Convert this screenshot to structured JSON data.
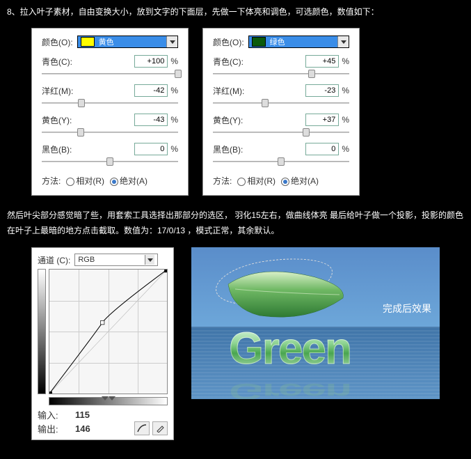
{
  "step8_text": "8、拉入叶子素材，自由变换大小，放到文字的下面层，先做一下体亮和调色，可选颜色，数值如下：",
  "panel_yellow": {
    "color_label": "颜色(O):",
    "name": "黄色",
    "cyan_label": "青色(C):",
    "cyan_val": "+100",
    "magenta_label": "洋红(M):",
    "magenta_val": "-42",
    "yellow_label": "黄色(Y):",
    "yellow_val": "-43",
    "black_label": "黑色(B):",
    "black_val": "0",
    "method": "方法:",
    "rel": "相对(R)",
    "abs": "绝对(A)",
    "pct": "%"
  },
  "panel_green": {
    "color_label": "颜色(O):",
    "name": "绿色",
    "cyan_label": "青色(C):",
    "cyan_val": "+45",
    "magenta_label": "洋红(M):",
    "magenta_val": "-23",
    "yellow_label": "黄色(Y):",
    "yellow_val": "+37",
    "black_label": "黑色(B):",
    "black_val": "0",
    "method": "方法:",
    "rel": "相对(R)",
    "abs": "绝对(A)",
    "pct": "%"
  },
  "paragraph2": "然后叶尖部分感觉暗了些，用套索工具选择出那部分的选区，  羽化15左右，做曲线体亮  最后给叶子做一个投影，投影的颜色在叶子上最暗的地方点击截取。数值为：17/0/13    ，模式正常，其余默认。",
  "curves": {
    "channel_label": "通道 (C):",
    "channel_value": "RGB",
    "input_label": "输入:",
    "input_val": "115",
    "output_label": "输出:",
    "output_val": "146"
  },
  "result_caption": "完成后效果",
  "green_word": "Green",
  "chart_data": {
    "type": "line",
    "title": "Curves Adjustment",
    "xlabel": "Input",
    "ylabel": "Output",
    "xlim": [
      0,
      255
    ],
    "ylim": [
      0,
      255
    ],
    "series": [
      {
        "name": "curve",
        "x": [
          0,
          115,
          255
        ],
        "y": [
          0,
          146,
          255
        ]
      }
    ],
    "channel": "RGB",
    "grid": true
  }
}
